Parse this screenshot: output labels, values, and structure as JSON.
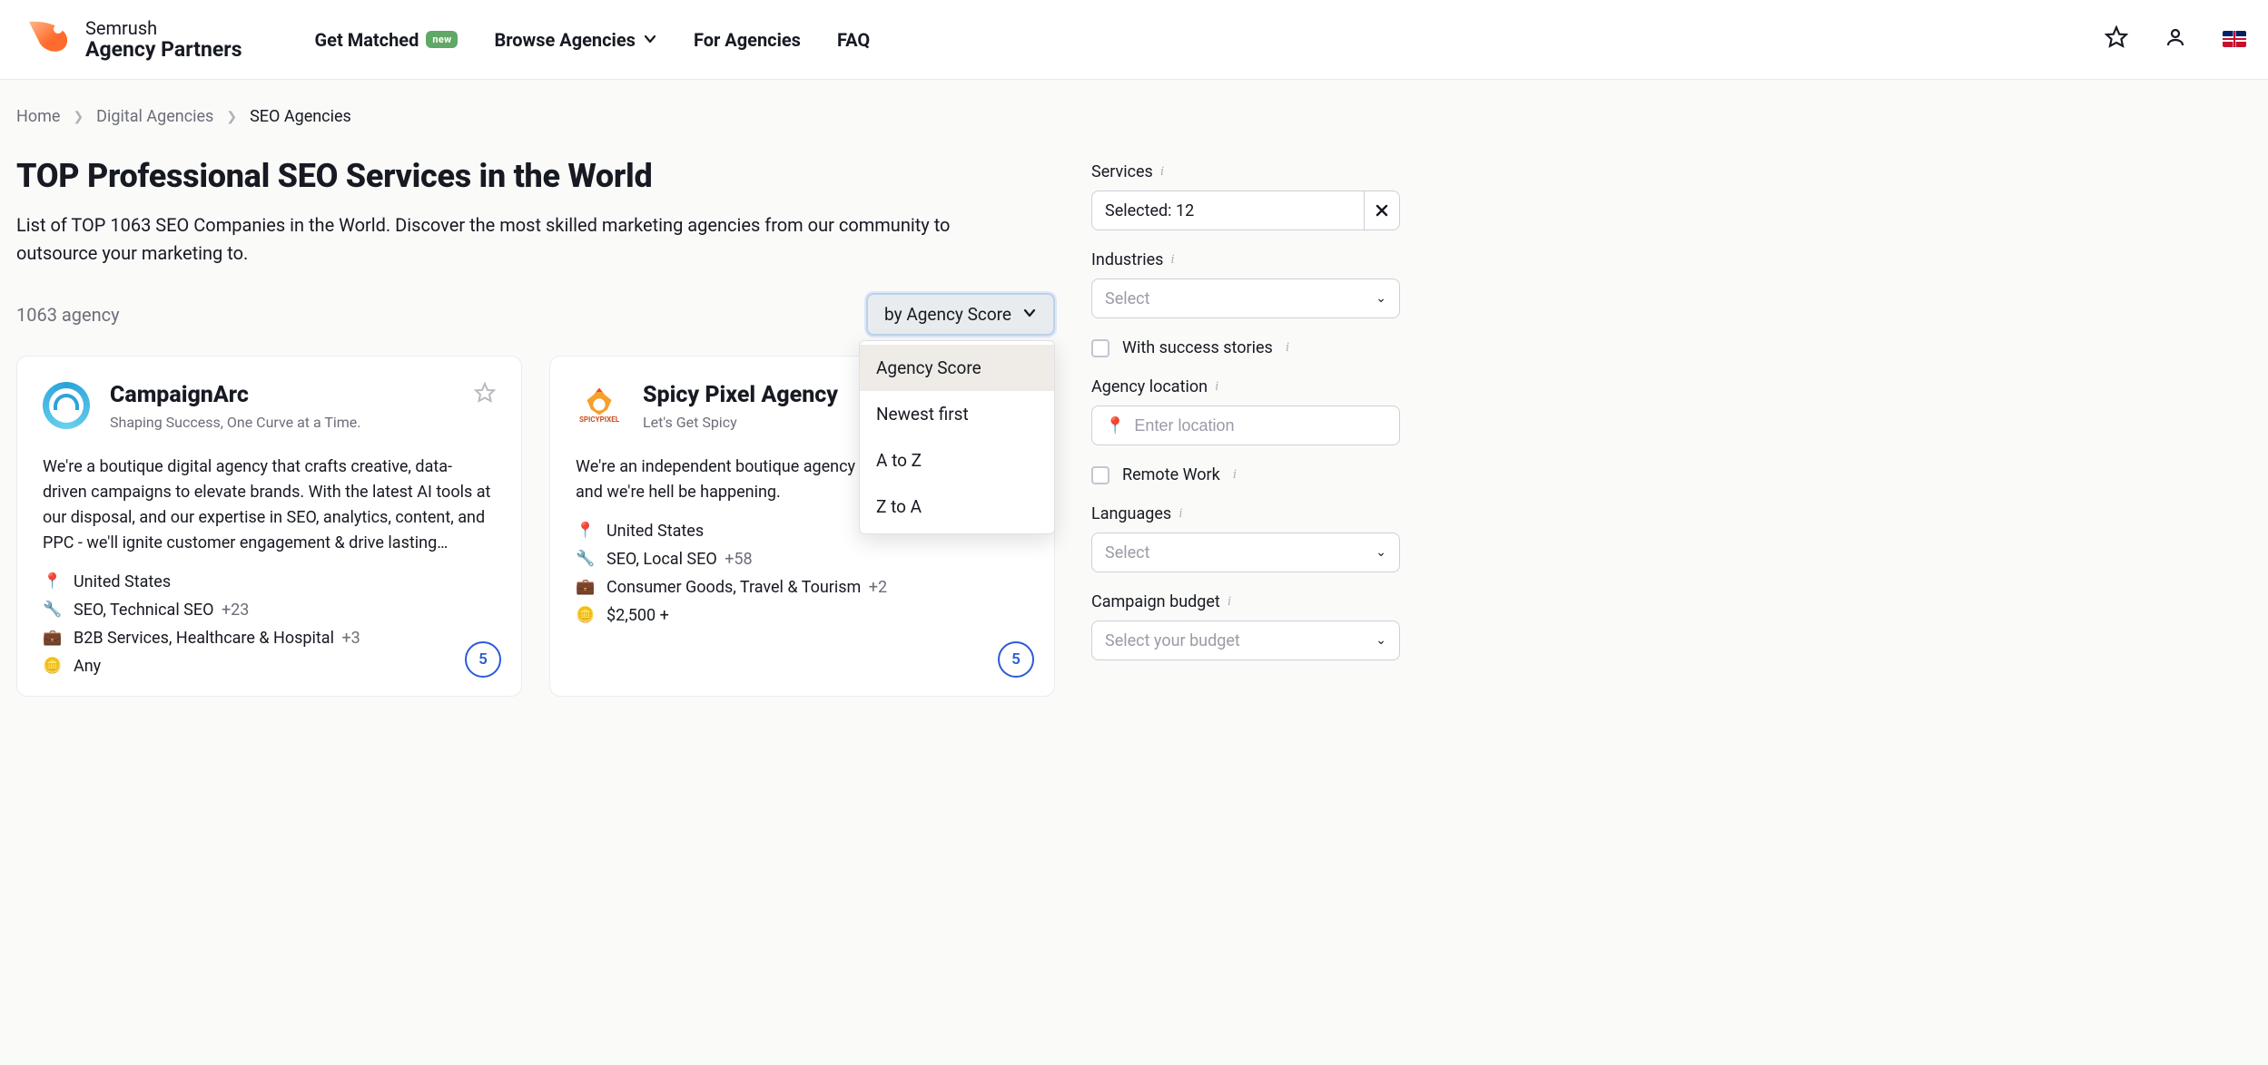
{
  "header": {
    "brand_line1": "Semrush",
    "brand_line2": "Agency Partners",
    "nav": {
      "get_matched": "Get Matched",
      "get_matched_badge": "new",
      "browse": "Browse Agencies",
      "for_agencies": "For Agencies",
      "faq": "FAQ"
    }
  },
  "breadcrumb": {
    "home": "Home",
    "level2": "Digital Agencies",
    "current": "SEO Agencies"
  },
  "page": {
    "title": "TOP Professional SEO Services in the World",
    "subtitle": "List of TOP 1063 SEO Companies in the World. Discover the most skilled marketing agencies from our community to outsource your marketing to.",
    "count_text": "1063 agency"
  },
  "sort": {
    "trigger": "by Agency Score",
    "options": [
      "Agency Score",
      "Newest first",
      "A to Z",
      "Z to A"
    ],
    "active_index": 0
  },
  "cards": [
    {
      "name": "CampaignArc",
      "tagline": "Shaping Success, One Curve at a Time.",
      "desc": "We're a boutique digital agency that crafts creative, data-driven campaigns to elevate brands. With the latest AI tools at our disposal, and our expertise in SEO, analytics, content, and PPC - we'll ignite customer engagement & drive lasting…",
      "location": "United States",
      "services": "SEO, Technical SEO",
      "services_more": "+23",
      "industries": "B2B Services, Healthcare & Hospital",
      "industries_more": "+3",
      "budget": "Any",
      "score": "5"
    },
    {
      "name": "Spicy Pixel Agency",
      "tagline": "Let's Get Spicy",
      "desc": "We're an independent boutique agency results for our clients and we're hell be happening.",
      "location": "United States",
      "services": "SEO, Local SEO",
      "services_more": "+58",
      "industries": "Consumer Goods, Travel & Tourism",
      "industries_more": "+2",
      "budget": "$2,500 +",
      "score": "5"
    }
  ],
  "filters": {
    "services_label": "Services",
    "services_value": "Selected: 12",
    "industries_label": "Industries",
    "industries_placeholder": "Select",
    "success_stories": "With success stories",
    "location_label": "Agency location",
    "location_placeholder": "Enter location",
    "remote_work": "Remote Work",
    "languages_label": "Languages",
    "languages_placeholder": "Select",
    "budget_label": "Campaign budget",
    "budget_placeholder": "Select your budget"
  }
}
